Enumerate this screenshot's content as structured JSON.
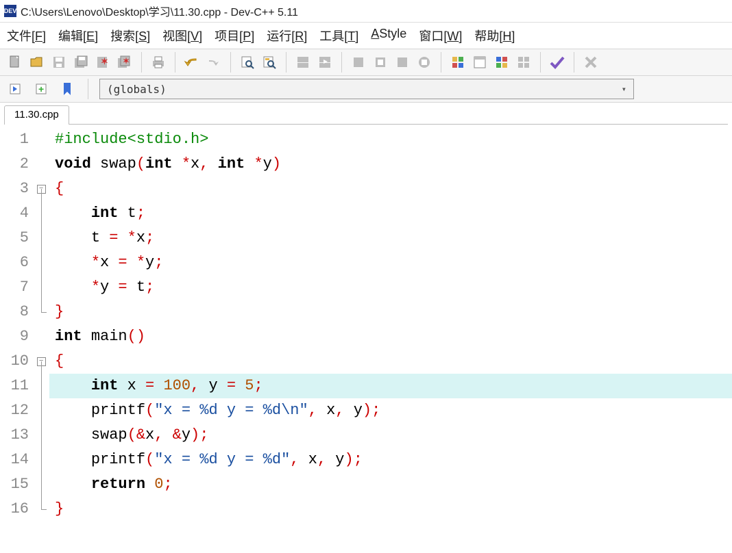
{
  "window": {
    "title_path": "C:\\Users\\Lenovo\\Desktop\\学习\\11.30.cpp - Dev-C++ 5.11",
    "app_icon_label": "DEV"
  },
  "menu": {
    "file": {
      "label": "文件",
      "accel": "F"
    },
    "edit": {
      "label": "编辑",
      "accel": "E"
    },
    "search": {
      "label": "搜索",
      "accel": "S"
    },
    "view": {
      "label": "视图",
      "accel": "V"
    },
    "project": {
      "label": "项目",
      "accel": "P"
    },
    "run": {
      "label": "运行",
      "accel": "R"
    },
    "tools": {
      "label": "工具",
      "accel": "T"
    },
    "astyle": {
      "label": "AStyle"
    },
    "window": {
      "label": "窗口",
      "accel": "W"
    },
    "help": {
      "label": "帮助",
      "accel": "H"
    }
  },
  "scope": {
    "value": "(globals)"
  },
  "tab": {
    "label": "11.30.cpp"
  },
  "editor": {
    "highlighted_line": 11,
    "lines": [
      {
        "n": 1,
        "fold": "",
        "tokens": [
          {
            "c": "tok-pp",
            "t": "#include<stdio.h>"
          }
        ]
      },
      {
        "n": 2,
        "fold": "",
        "tokens": [
          {
            "c": "tok-kw",
            "t": "void"
          },
          {
            "c": "",
            "t": " "
          },
          {
            "c": "tok-id",
            "t": "swap"
          },
          {
            "c": "tok-brace",
            "t": "("
          },
          {
            "c": "tok-kw",
            "t": "int"
          },
          {
            "c": "",
            "t": " "
          },
          {
            "c": "tok-op",
            "t": "*"
          },
          {
            "c": "tok-id",
            "t": "x"
          },
          {
            "c": "tok-op",
            "t": ","
          },
          {
            "c": "",
            "t": " "
          },
          {
            "c": "tok-kw",
            "t": "int"
          },
          {
            "c": "",
            "t": " "
          },
          {
            "c": "tok-op",
            "t": "*"
          },
          {
            "c": "tok-id",
            "t": "y"
          },
          {
            "c": "tok-brace",
            "t": ")"
          }
        ]
      },
      {
        "n": 3,
        "fold": "open",
        "tokens": [
          {
            "c": "tok-brace",
            "t": "{"
          }
        ]
      },
      {
        "n": 4,
        "fold": "mid",
        "indent": 1,
        "tokens": [
          {
            "c": "tok-kw",
            "t": "int"
          },
          {
            "c": "",
            "t": " "
          },
          {
            "c": "tok-id",
            "t": "t"
          },
          {
            "c": "tok-op",
            "t": ";"
          }
        ]
      },
      {
        "n": 5,
        "fold": "mid",
        "indent": 1,
        "tokens": [
          {
            "c": "tok-id",
            "t": "t "
          },
          {
            "c": "tok-op",
            "t": "="
          },
          {
            "c": "",
            "t": " "
          },
          {
            "c": "tok-op",
            "t": "*"
          },
          {
            "c": "tok-id",
            "t": "x"
          },
          {
            "c": "tok-op",
            "t": ";"
          }
        ]
      },
      {
        "n": 6,
        "fold": "mid",
        "indent": 1,
        "tokens": [
          {
            "c": "tok-op",
            "t": "*"
          },
          {
            "c": "tok-id",
            "t": "x "
          },
          {
            "c": "tok-op",
            "t": "="
          },
          {
            "c": "",
            "t": " "
          },
          {
            "c": "tok-op",
            "t": "*"
          },
          {
            "c": "tok-id",
            "t": "y"
          },
          {
            "c": "tok-op",
            "t": ";"
          }
        ]
      },
      {
        "n": 7,
        "fold": "mid",
        "indent": 1,
        "tokens": [
          {
            "c": "tok-op",
            "t": "*"
          },
          {
            "c": "tok-id",
            "t": "y "
          },
          {
            "c": "tok-op",
            "t": "="
          },
          {
            "c": "",
            "t": " "
          },
          {
            "c": "tok-id",
            "t": "t"
          },
          {
            "c": "tok-op",
            "t": ";"
          }
        ]
      },
      {
        "n": 8,
        "fold": "end",
        "tokens": [
          {
            "c": "tok-brace",
            "t": "}"
          }
        ]
      },
      {
        "n": 9,
        "fold": "",
        "tokens": [
          {
            "c": "tok-kw",
            "t": "int"
          },
          {
            "c": "",
            "t": " "
          },
          {
            "c": "tok-id",
            "t": "main"
          },
          {
            "c": "tok-brace",
            "t": "()"
          }
        ]
      },
      {
        "n": 10,
        "fold": "open",
        "tokens": [
          {
            "c": "tok-brace",
            "t": "{"
          }
        ]
      },
      {
        "n": 11,
        "fold": "mid",
        "indent": 1,
        "tokens": [
          {
            "c": "tok-kw",
            "t": "int"
          },
          {
            "c": "",
            "t": " "
          },
          {
            "c": "tok-id",
            "t": "x "
          },
          {
            "c": "tok-op",
            "t": "="
          },
          {
            "c": "",
            "t": " "
          },
          {
            "c": "tok-num",
            "t": "100"
          },
          {
            "c": "tok-op",
            "t": ","
          },
          {
            "c": "",
            "t": " "
          },
          {
            "c": "tok-id",
            "t": "y "
          },
          {
            "c": "tok-op",
            "t": "="
          },
          {
            "c": "",
            "t": " "
          },
          {
            "c": "tok-num",
            "t": "5"
          },
          {
            "c": "tok-op",
            "t": ";"
          }
        ]
      },
      {
        "n": 12,
        "fold": "mid",
        "indent": 1,
        "tokens": [
          {
            "c": "tok-id",
            "t": "printf"
          },
          {
            "c": "tok-brace",
            "t": "("
          },
          {
            "c": "tok-str",
            "t": "\"x = %d y = %d\\n\""
          },
          {
            "c": "tok-op",
            "t": ","
          },
          {
            "c": "",
            "t": " "
          },
          {
            "c": "tok-id",
            "t": "x"
          },
          {
            "c": "tok-op",
            "t": ","
          },
          {
            "c": "",
            "t": " "
          },
          {
            "c": "tok-id",
            "t": "y"
          },
          {
            "c": "tok-brace",
            "t": ")"
          },
          {
            "c": "tok-op",
            "t": ";"
          }
        ]
      },
      {
        "n": 13,
        "fold": "mid",
        "indent": 1,
        "tokens": [
          {
            "c": "tok-id",
            "t": "swap"
          },
          {
            "c": "tok-brace",
            "t": "("
          },
          {
            "c": "tok-op",
            "t": "&"
          },
          {
            "c": "tok-id",
            "t": "x"
          },
          {
            "c": "tok-op",
            "t": ","
          },
          {
            "c": "",
            "t": " "
          },
          {
            "c": "tok-op",
            "t": "&"
          },
          {
            "c": "tok-id",
            "t": "y"
          },
          {
            "c": "tok-brace",
            "t": ")"
          },
          {
            "c": "tok-op",
            "t": ";"
          }
        ]
      },
      {
        "n": 14,
        "fold": "mid",
        "indent": 1,
        "tokens": [
          {
            "c": "tok-id",
            "t": "printf"
          },
          {
            "c": "tok-brace",
            "t": "("
          },
          {
            "c": "tok-str",
            "t": "\"x = %d y = %d\""
          },
          {
            "c": "tok-op",
            "t": ","
          },
          {
            "c": "",
            "t": " "
          },
          {
            "c": "tok-id",
            "t": "x"
          },
          {
            "c": "tok-op",
            "t": ","
          },
          {
            "c": "",
            "t": " "
          },
          {
            "c": "tok-id",
            "t": "y"
          },
          {
            "c": "tok-brace",
            "t": ")"
          },
          {
            "c": "tok-op",
            "t": ";"
          }
        ]
      },
      {
        "n": 15,
        "fold": "mid",
        "indent": 1,
        "tokens": [
          {
            "c": "tok-kw",
            "t": "return"
          },
          {
            "c": "",
            "t": " "
          },
          {
            "c": "tok-num",
            "t": "0"
          },
          {
            "c": "tok-op",
            "t": ";"
          }
        ]
      },
      {
        "n": 16,
        "fold": "end",
        "tokens": [
          {
            "c": "tok-brace",
            "t": "}"
          }
        ]
      }
    ]
  }
}
